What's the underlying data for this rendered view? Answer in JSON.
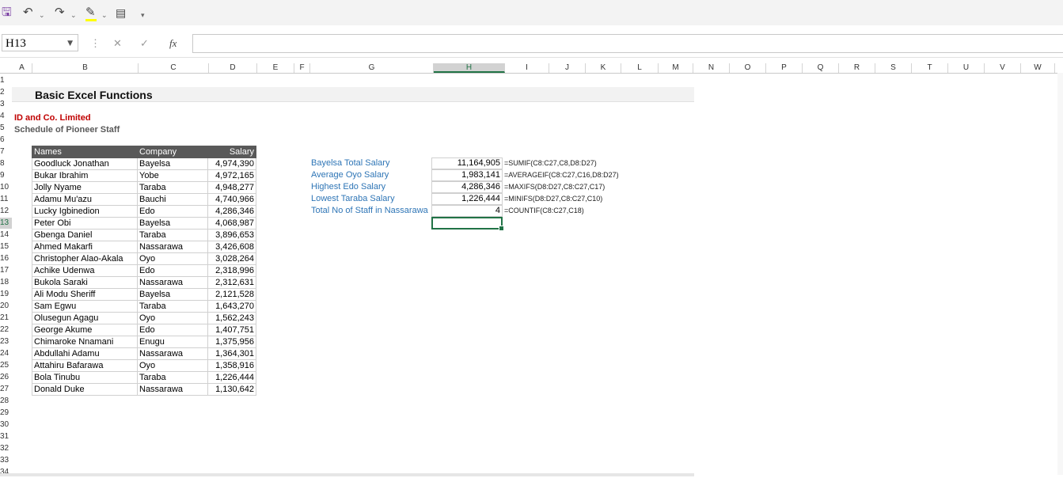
{
  "toolbar": {
    "icons": [
      "save-icon",
      "undo-icon",
      "redo-icon",
      "fill-color-icon",
      "form-icon",
      "customize-icon"
    ]
  },
  "formula_bar": {
    "name_box": "H13",
    "formula": "",
    "fx_label": "fx"
  },
  "columns": [
    "A",
    "B",
    "C",
    "D",
    "E",
    "F",
    "G",
    "H",
    "I",
    "J",
    "K",
    "L",
    "M",
    "N",
    "O",
    "P",
    "Q",
    "R",
    "S",
    "T",
    "U",
    "V",
    "W"
  ],
  "selected_column": "H",
  "rows": [
    "1",
    "2",
    "3",
    "4",
    "5",
    "6",
    "7",
    "8",
    "9",
    "10",
    "11",
    "12",
    "13",
    "14",
    "15",
    "16",
    "17",
    "18",
    "19",
    "20",
    "21",
    "22",
    "23",
    "24",
    "25",
    "26",
    "27",
    "28",
    "29",
    "30",
    "31",
    "32",
    "33",
    "34"
  ],
  "selected_row": "13",
  "sheet": {
    "title": "Basic Excel Functions",
    "company": "ID and Co. Limited",
    "subtitle": "Schedule of Pioneer Staff"
  },
  "table": {
    "headers": [
      "Names",
      "Company",
      "Salary"
    ],
    "rows": [
      [
        "Goodluck Jonathan",
        "Bayelsa",
        "4,974,390"
      ],
      [
        "Bukar Ibrahim",
        "Yobe",
        "4,972,165"
      ],
      [
        "Jolly Nyame",
        "Taraba",
        "4,948,277"
      ],
      [
        "Adamu Mu'azu",
        "Bauchi",
        "4,740,966"
      ],
      [
        "Lucky Igbinedion",
        "Edo",
        "4,286,346"
      ],
      [
        "Peter Obi",
        "Bayelsa",
        "4,068,987"
      ],
      [
        "Gbenga Daniel",
        "Taraba",
        "3,896,653"
      ],
      [
        "Ahmed Makarfi",
        "Nassarawa",
        "3,426,608"
      ],
      [
        "Christopher Alao-Akala",
        "Oyo",
        "3,028,264"
      ],
      [
        "Achike Udenwa",
        "Edo",
        "2,318,996"
      ],
      [
        "Bukola Saraki",
        "Nassarawa",
        "2,312,631"
      ],
      [
        "Ali Modu Sheriff",
        "Bayelsa",
        "2,121,528"
      ],
      [
        "Sam Egwu",
        "Taraba",
        "1,643,270"
      ],
      [
        "Olusegun Agagu",
        "Oyo",
        "1,562,243"
      ],
      [
        "George Akume",
        "Edo",
        "1,407,751"
      ],
      [
        "Chimaroke Nnamani",
        "Enugu",
        "1,375,956"
      ],
      [
        "Abdullahi Adamu",
        "Nassarawa",
        "1,364,301"
      ],
      [
        "Attahiru Bafarawa",
        "Oyo",
        "1,358,916"
      ],
      [
        "Bola Tinubu",
        "Taraba",
        "1,226,444"
      ],
      [
        "Donald Duke",
        "Nassarawa",
        "1,130,642"
      ]
    ]
  },
  "summary": [
    {
      "label": "Bayelsa Total Salary",
      "value": "11,164,905",
      "formula": "=SUMIF(C8:C27,C8,D8:D27)"
    },
    {
      "label": "Average Oyo Salary",
      "value": "1,983,141",
      "formula": "=AVERAGEIF(C8:C27,C16,D8:D27)"
    },
    {
      "label": "Highest Edo Salary",
      "value": "4,286,346",
      "formula": "=MAXIFS(D8:D27,C8:C27,C17)"
    },
    {
      "label": "Lowest Taraba Salary",
      "value": "1,226,444",
      "formula": "=MINIFS(D8:D27,C8:C27,C10)"
    },
    {
      "label": "Total No of Staff in Nassarawa",
      "value": "4",
      "formula": "=COUNTIF(C8:C27,C18)"
    }
  ],
  "colors": {
    "accent": "#217346",
    "company_red": "#c00000",
    "label_blue": "#2e75b6",
    "header_gray": "#595959"
  }
}
